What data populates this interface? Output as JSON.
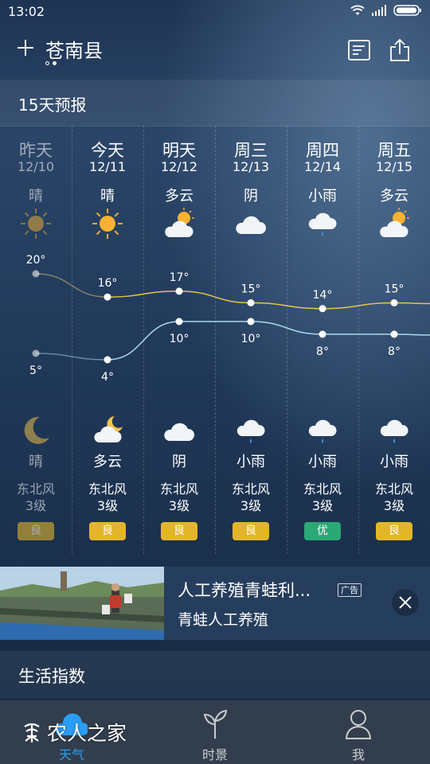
{
  "status_bar": {
    "time": "13:02"
  },
  "header": {
    "city": "苍南县"
  },
  "forecast": {
    "title": "15天预报",
    "days": [
      {
        "day": "昨天",
        "date": "12/10",
        "day_cond": "晴",
        "day_icon": "sun-icon",
        "night_icon": "moon-icon",
        "night_cond": "晴",
        "wind": "东北风",
        "level": "3级",
        "aqi": "良",
        "aqi_color": "#e3b52a"
      },
      {
        "day": "今天",
        "date": "12/11",
        "day_cond": "晴",
        "day_icon": "sun-icon",
        "night_icon": "moon-cloud-icon",
        "night_cond": "多云",
        "wind": "东北风",
        "level": "3级",
        "aqi": "良",
        "aqi_color": "#e3b52a"
      },
      {
        "day": "明天",
        "date": "12/12",
        "day_cond": "多云",
        "day_icon": "sun-cloud-icon",
        "night_icon": "cloud-icon",
        "night_cond": "阴",
        "wind": "东北风",
        "level": "3级",
        "aqi": "良",
        "aqi_color": "#e3b52a"
      },
      {
        "day": "周三",
        "date": "12/13",
        "day_cond": "阴",
        "day_icon": "cloud-icon",
        "night_icon": "rain-cloud-icon",
        "night_cond": "小雨",
        "wind": "东北风",
        "level": "3级",
        "aqi": "良",
        "aqi_color": "#e3b52a"
      },
      {
        "day": "周四",
        "date": "12/14",
        "day_cond": "小雨",
        "day_icon": "rain-cloud-icon",
        "night_icon": "rain-cloud-icon",
        "night_cond": "小雨",
        "wind": "东北风",
        "level": "3级",
        "aqi": "优",
        "aqi_color": "#2aa876"
      },
      {
        "day": "周五",
        "date": "12/15",
        "day_cond": "多云",
        "day_icon": "sun-cloud-icon",
        "night_icon": "rain-cloud-icon",
        "night_cond": "小雨",
        "wind": "东北风",
        "level": "3级",
        "aqi": "良",
        "aqi_color": "#e3b52a"
      }
    ],
    "high_temps": [
      "20°",
      "16°",
      "17°",
      "15°",
      "14°",
      "15°"
    ],
    "low_temps": [
      "5°",
      "4°",
      "10°",
      "10°",
      "8°",
      "8°"
    ],
    "high_values": [
      20,
      16,
      17,
      15,
      14,
      15
    ],
    "low_values": [
      5,
      4,
      10,
      10,
      8,
      8
    ],
    "high_color": "#e8c545",
    "low_color": "#a9d8f0"
  },
  "ad": {
    "title": "人工养殖青蛙利...",
    "tag": "广告",
    "subtitle": "青蛙人工养殖"
  },
  "life": {
    "title": "生活指数"
  },
  "nav": {
    "items": [
      {
        "label": "天气",
        "icon": "cloud-icon"
      },
      {
        "label": "时景",
        "icon": "sprout-icon"
      },
      {
        "label": "我",
        "icon": "user-icon"
      }
    ]
  },
  "watermark": {
    "text": "农人之家"
  }
}
